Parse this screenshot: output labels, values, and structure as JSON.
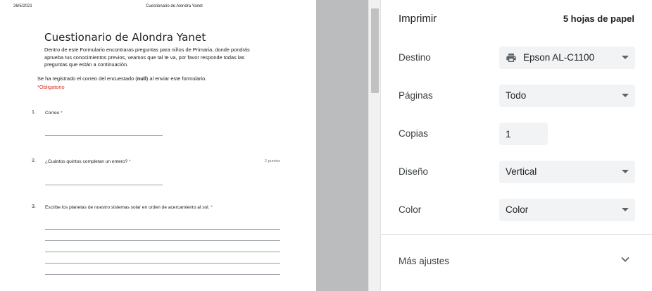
{
  "preview": {
    "header_date": "26/5/2021",
    "header_title": "Cuestionario de Alondra Yanet",
    "form_title": "Cuestionario de Alondra Yanet",
    "description_lines": [
      "Dentro de este Formulario encontraras preguntas para niños de Primaria, donde pondrás",
      "aprueba tus conocimientos previos, veamos que tal te va, por favor responde  todas las",
      "preguntas que están a continuación."
    ],
    "email_note_before": "Se ha registrado el correo del encuestado (",
    "email_note_bold": "null",
    "email_note_after": ") al enviar este formulario.",
    "required_note": "*Obligatorio",
    "questions": [
      {
        "number": "1.",
        "text": "Correo",
        "required": "*",
        "points": ""
      },
      {
        "number": "2.",
        "text": "¿Cuántos quintos completan un entero?",
        "required": "*",
        "points": "2 puntos"
      },
      {
        "number": "3.",
        "text": "Escribe los planetas de nuestro sistemas solar en orden de acercamiento al sol.",
        "required": "*",
        "points": ""
      }
    ]
  },
  "panel": {
    "title": "Imprimir",
    "sheet_count": "5 hojas de papel",
    "destination_label": "Destino",
    "destination_value": "Epson AL-C1100",
    "pages_label": "Páginas",
    "pages_value": "Todo",
    "copies_label": "Copias",
    "copies_value": "1",
    "layout_label": "Diseño",
    "layout_value": "Vertical",
    "color_label": "Color",
    "color_value": "Color",
    "more_settings_label": "Más ajustes"
  },
  "colors": {
    "required_red": "#d93025",
    "control_bg": "#f1f3f4",
    "preview_bg": "#babcbe"
  },
  "icons": [
    "printer-icon",
    "dropdown-caret-icon",
    "chevron-down-icon"
  ]
}
